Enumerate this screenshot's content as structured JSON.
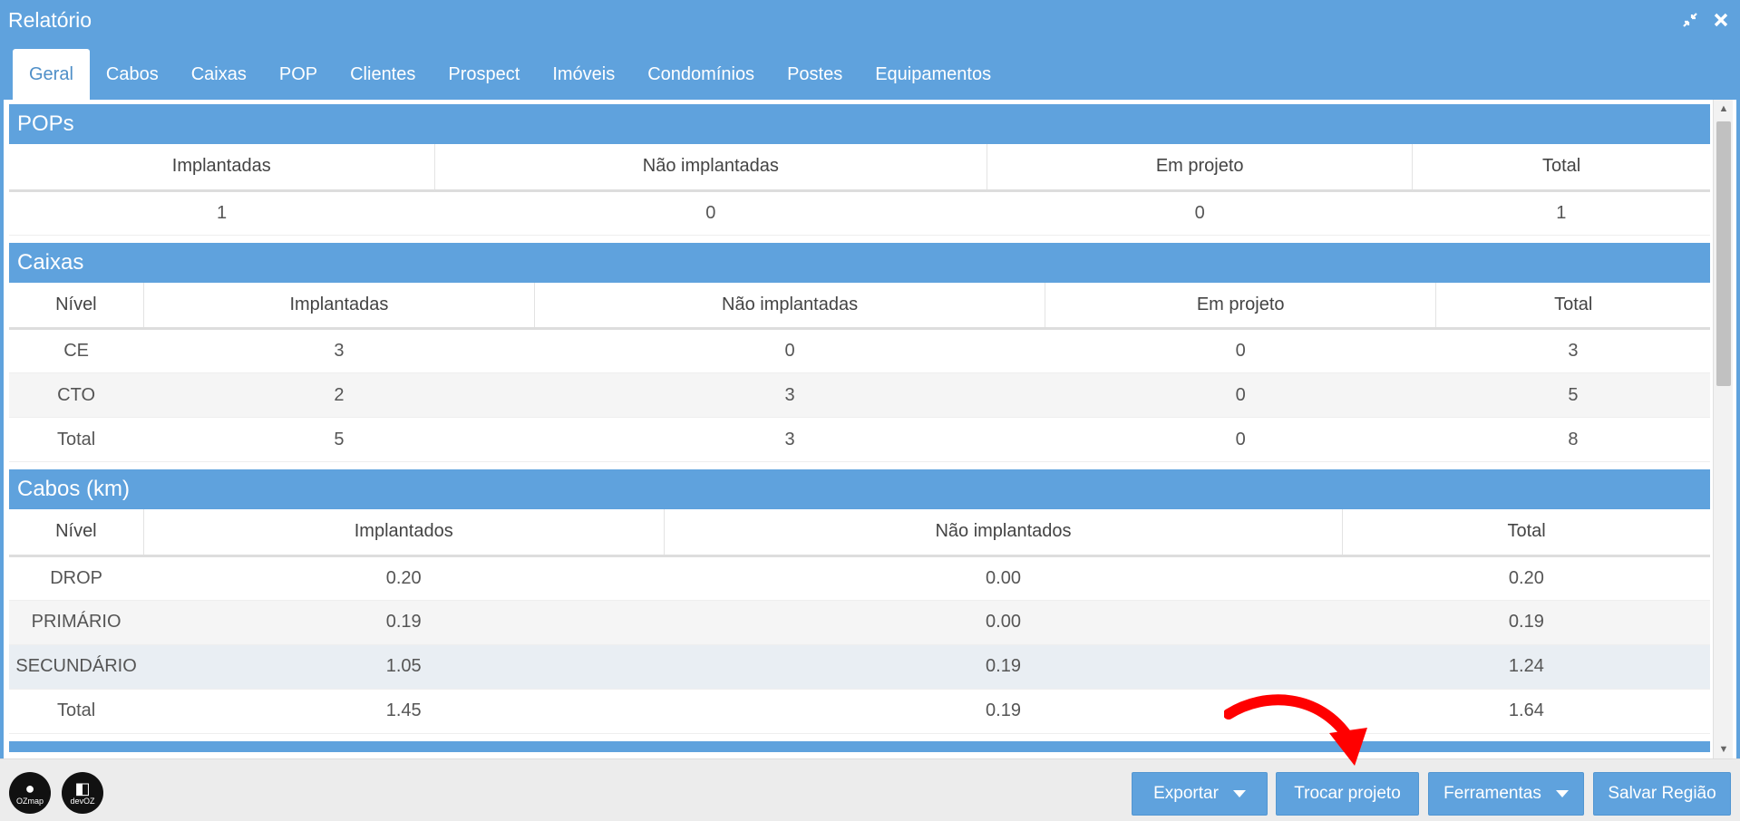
{
  "window": {
    "title": "Relatório"
  },
  "tabs": [
    "Geral",
    "Cabos",
    "Caixas",
    "POP",
    "Clientes",
    "Prospect",
    "Imóveis",
    "Condomínios",
    "Postes",
    "Equipamentos"
  ],
  "pops": {
    "title": "POPs",
    "headers": [
      "Implantadas",
      "Não implantadas",
      "Em projeto",
      "Total"
    ],
    "rows": [
      [
        "1",
        "0",
        "0",
        "1"
      ]
    ]
  },
  "caixas": {
    "title": "Caixas",
    "headers": [
      "Nível",
      "Implantadas",
      "Não implantadas",
      "Em projeto",
      "Total"
    ],
    "rows": [
      [
        "CE",
        "3",
        "0",
        "0",
        "3"
      ],
      [
        "CTO",
        "2",
        "3",
        "0",
        "5"
      ],
      [
        "Total",
        "5",
        "3",
        "0",
        "8"
      ]
    ]
  },
  "cabos": {
    "title": "Cabos (km)",
    "headers": [
      "Nível",
      "Implantados",
      "Não implantados",
      "Total"
    ],
    "rows": [
      [
        "DROP",
        "0.20",
        "0.00",
        "0.20"
      ],
      [
        "PRIMÁRIO",
        "0.19",
        "0.00",
        "0.19"
      ],
      [
        "SECUNDÁRIO",
        "1.05",
        "0.19",
        "1.24"
      ],
      [
        "Total",
        "1.45",
        "0.19",
        "1.64"
      ]
    ]
  },
  "footer": {
    "logo1": "OZmap",
    "logo2": "devOZ",
    "buttons": {
      "exportar": "Exportar",
      "trocar_projeto": "Trocar projeto",
      "ferramentas": "Ferramentas",
      "salvar_regiao": "Salvar Região"
    }
  },
  "colors": {
    "accent": "#5fa2dd",
    "annotation_arrow": "#ff0000"
  }
}
